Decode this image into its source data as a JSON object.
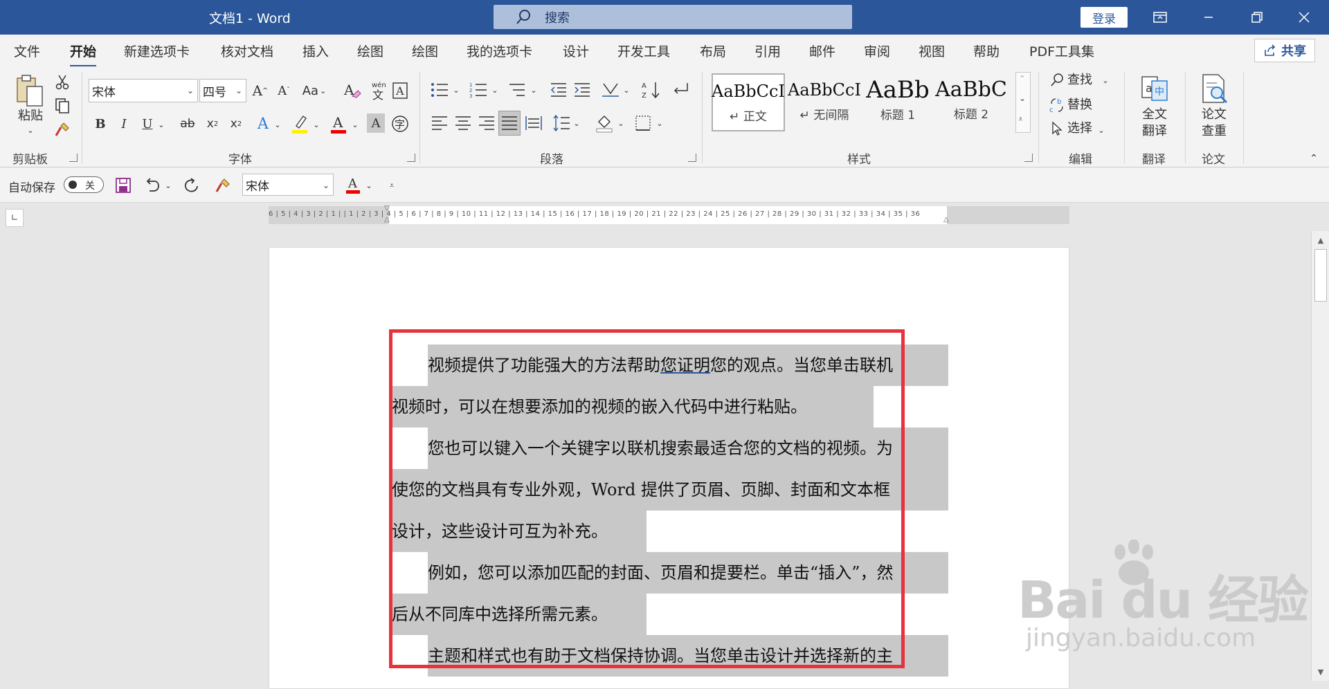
{
  "titlebar": {
    "title": "文档1  -  Word",
    "search_label": "搜索",
    "login": "登录"
  },
  "tabs": [
    "文件",
    "开始",
    "新建选项卡",
    "核对文档",
    "插入",
    "绘图",
    "绘图",
    "我的选项卡",
    "设计",
    "开发工具",
    "布局",
    "引用",
    "邮件",
    "审阅",
    "视图",
    "帮助",
    "PDF工具集"
  ],
  "active_tab": "开始",
  "share": "共享",
  "ribbon": {
    "clipboard": {
      "paste": "粘贴",
      "label": "剪贴板"
    },
    "font": {
      "name": "宋体",
      "size": "四号",
      "label": "字体",
      "change_case": "Aa"
    },
    "paragraph": {
      "label": "段落"
    },
    "styles": {
      "label": "样式",
      "items": [
        {
          "sample": "AaBbCcI",
          "name": "↵ 正文"
        },
        {
          "sample": "AaBbCcI",
          "name": "↵ 无间隔"
        },
        {
          "sample": "AaBb",
          "name": "标题 1"
        },
        {
          "sample": "AaBbC",
          "name": "标题 2"
        }
      ]
    },
    "editing": {
      "find": "查找",
      "replace": "替换",
      "select": "选择",
      "label": "编辑"
    },
    "translate": {
      "full": "全文\n翻译",
      "label": "翻译"
    },
    "paper": {
      "check": "论文\n查重",
      "label": "论文"
    }
  },
  "qat": {
    "autosave": "自动保存",
    "toggle_state": "关",
    "font_name": "宋体"
  },
  "ruler_numbers": "6 | 5 | 4 | 3 | 2 | 1 |  |  1 | 2 | 3 | 4 | 5 | 6 | 7 | 8 | 9 | 10 | 11 | 12 | 13 | 14 | 15 | 16 | 17 | 18 | 19 | 20 | 21 | 22 | 23 | 24 | 25 | 26 | 27 | 28 | 29 | 30 | 31 | 32 | 33 | 34 | 35 | 36",
  "document": {
    "lines": [
      {
        "pre": "视频提供了功能强大的方法帮助",
        "link": "您证明",
        "post": "您的观点。当您单击联机"
      },
      {
        "text": "视频时，可以在想要添加的视频的嵌入代码中进行粘贴。"
      },
      {
        "text": "您也可以键入一个关键字以联机搜索最适合您的文档的视频。为"
      },
      {
        "text": "使您的文档具有专业外观，Word 提供了页眉、页脚、封面和文本框"
      },
      {
        "text": "设计，这些设计可互为补充。"
      },
      {
        "text": "例如，您可以添加匹配的封面、页眉和提要栏。单击“插入”，然"
      },
      {
        "text": "后从不同库中选择所需元素。"
      },
      {
        "text": "主题和样式也有助于文档保持协调。当您单击设计并选择新的主"
      }
    ]
  },
  "watermark": {
    "main": "Bai du 经验",
    "sub": "jingyan.baidu.com"
  },
  "colors": {
    "title_bar": "#2b579a",
    "highlight": "#c8c8c8",
    "red_box": "#e8323c"
  }
}
